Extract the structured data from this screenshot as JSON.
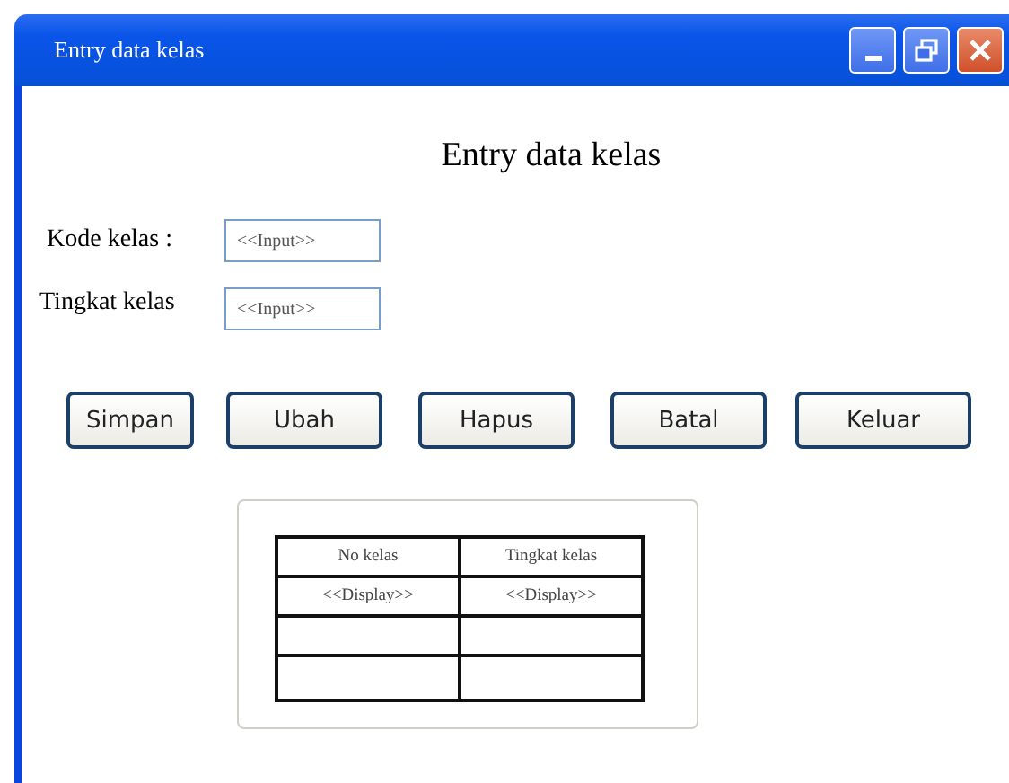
{
  "window": {
    "title": "Entry data kelas"
  },
  "heading": "Entry data kelas",
  "fields": [
    {
      "label": "Kode kelas :",
      "value": "<<Input>>"
    },
    {
      "label": "Tingkat kelas",
      "value": "<<Input>>"
    }
  ],
  "buttons": [
    "Simpan",
    "Ubah",
    "Hapus",
    "Batal",
    "Keluar"
  ],
  "table": {
    "columns": [
      "No kelas",
      "Tingkat kelas"
    ],
    "rows": [
      [
        "<<Display>>",
        "<<Display>>"
      ]
    ]
  }
}
